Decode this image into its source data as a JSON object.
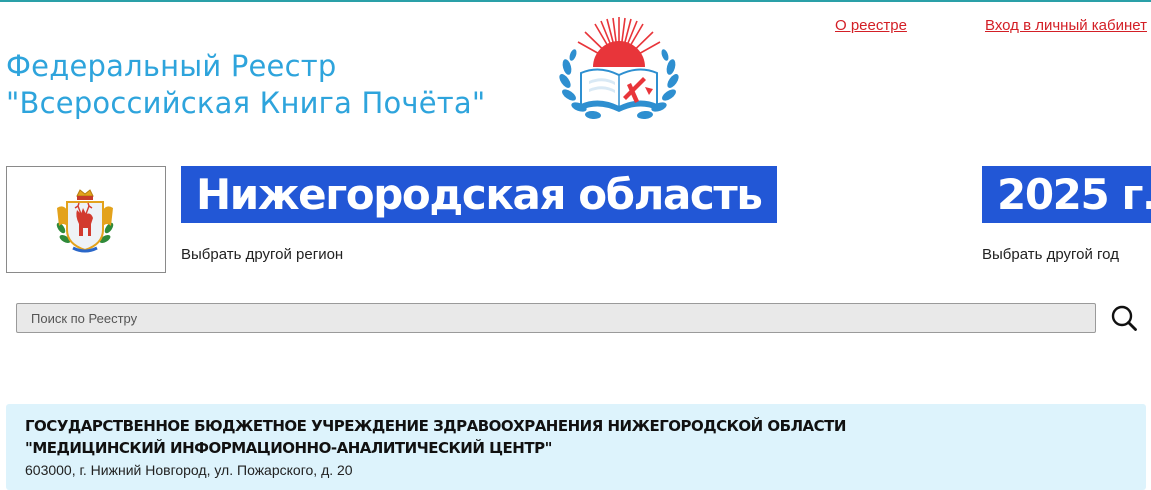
{
  "header": {
    "title_line1": "Федеральный Реестр",
    "title_line2": "\"Всероссийская Книга Почёта\"",
    "logo_icon": "open-book-laurel-icon",
    "link_about": "О реестре",
    "link_login": "Вход в личный кабинет"
  },
  "region": {
    "emblem_icon": "nizhny-novgorod-coat-of-arms-icon",
    "name": "Нижегородская область",
    "choose_label": "Выбрать другой регион"
  },
  "year": {
    "value": "2025 г.",
    "choose_label": "Выбрать другой год"
  },
  "search": {
    "placeholder": "Поиск по Реестру",
    "value": "",
    "icon": "search-icon"
  },
  "results": [
    {
      "name": "ГОСУДАРСТВЕННОЕ БЮДЖЕТНОЕ УЧРЕЖДЕНИЕ ЗДРАВООХРАНЕНИЯ НИЖЕГОРОДСКОЙ ОБЛАСТИ \"МЕДИЦИНСКИЙ ИНФОРМАЦИОННО-АНАЛИТИЧЕСКИЙ ЦЕНТР\"",
      "address": "603000, г. Нижний Новгород, ул. Пожарского, д. 20"
    }
  ],
  "colors": {
    "accent_blue": "#2257d6",
    "title_blue": "#2ea4dc",
    "link_red": "#d31f26",
    "card_bg": "#ddf3fc"
  }
}
